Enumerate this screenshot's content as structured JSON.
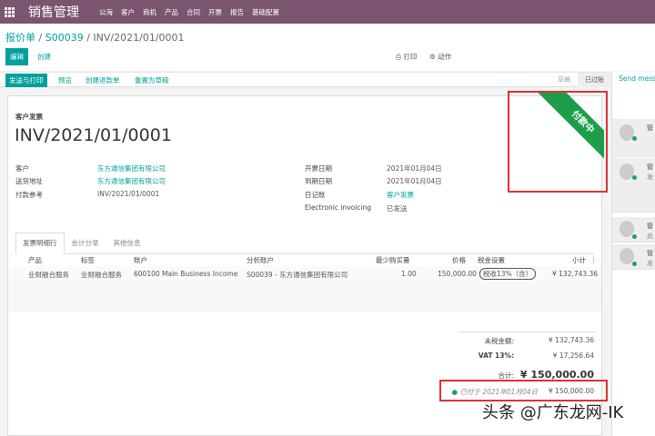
{
  "app": {
    "title": "销售管理",
    "menu": [
      "公海",
      "客户",
      "商机",
      "产品",
      "合同",
      "开票",
      "报告",
      "基础配置"
    ]
  },
  "breadcrumb": {
    "root": "报价单",
    "order": "S00039",
    "current": "INV/2021/01/0001",
    "sep": "/"
  },
  "toolbar": {
    "edit": "编辑",
    "create": "创建",
    "print": "打印",
    "action": "动作"
  },
  "statusbar": {
    "buttons": [
      "发送与打印",
      "预览",
      "创建退款单",
      "重置为草稿"
    ],
    "stages": [
      "草稿",
      "已过账"
    ],
    "current_stage": "已过账"
  },
  "chatter": {
    "send": "Send message",
    "messages": [
      {
        "author": "管",
        "text": ""
      },
      {
        "author": "管",
        "text": "发"
      },
      {
        "author": "管",
        "text": "此"
      },
      {
        "author": "管",
        "text": "发"
      }
    ]
  },
  "invoice": {
    "type": "客户发票",
    "number": "INV/2021/01/0001",
    "ribbon": "付款中",
    "left": [
      {
        "label": "客户",
        "value": "东方通信集团有限公司",
        "link": true
      },
      {
        "label": "送货地址",
        "value": "东方通信集团有限公司",
        "link": true
      },
      {
        "label": "付款参考",
        "value": "INV/2021/01/0001",
        "link": false
      }
    ],
    "right": [
      {
        "label": "开票日期",
        "value": "2021年01月04日",
        "link": false
      },
      {
        "label": "到期日期",
        "value": "2021年01月04日",
        "link": false
      },
      {
        "label": "日记账",
        "value": "客户发票",
        "link": true
      },
      {
        "label": "Electronic invoicing",
        "value": "已发送",
        "link": false
      }
    ]
  },
  "tabs": [
    "发票明细行",
    "会计分录",
    "其他信息"
  ],
  "table": {
    "headers": [
      "产品",
      "标签",
      "账户",
      "分析账户",
      "最少购买量",
      "价格",
      "税金设置",
      "小计"
    ],
    "rows": [
      {
        "product": "业财融合服务",
        "label": "业财融合服务",
        "account": "600100 Main Business Income",
        "analytic": "S00039 - 东方通信集团有限公司",
        "qty": "1.00",
        "price": "150,000.00",
        "tax": "税收13%（含）",
        "subtotal": "¥ 132,743.36"
      }
    ]
  },
  "totals": {
    "untaxed_label": "未税金额:",
    "untaxed": "¥ 132,743.36",
    "vat_label": "VAT 13%:",
    "vat": "¥ 17,256.64",
    "total_label": "合计:",
    "total": "¥ 150,000.00",
    "paid_label": "已付于 2021年01月04日",
    "paid": "¥ 150,000.00"
  },
  "watermark": "头条 @广东龙网-IK"
}
